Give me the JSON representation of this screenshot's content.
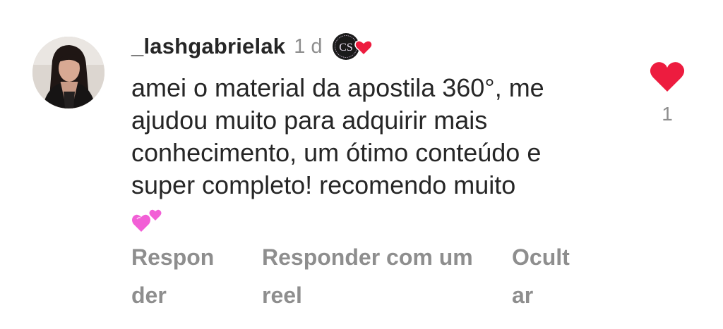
{
  "comment": {
    "username": "_lashgabrielak",
    "time": "1 d",
    "creator_badge_text": "CS",
    "text_lines": [
      "amei o material da apostila 360°, me",
      "ajudou muito para adquirir mais",
      "conhecimento, um ótimo conteúdo e",
      "super completo! recomendo muito"
    ],
    "trailing_emoji": "two-hearts-icon",
    "liked": true,
    "like_count": "1",
    "colors": {
      "like_red": "#ed1c3f",
      "text": "#262626",
      "muted": "#8e8e8e",
      "emoji_pink": "#f25fd6"
    }
  },
  "actions": {
    "reply": [
      "Respon",
      "der"
    ],
    "reply_with_reel": [
      "Responder com um",
      "reel"
    ],
    "hide": [
      "Ocult",
      "ar"
    ]
  }
}
